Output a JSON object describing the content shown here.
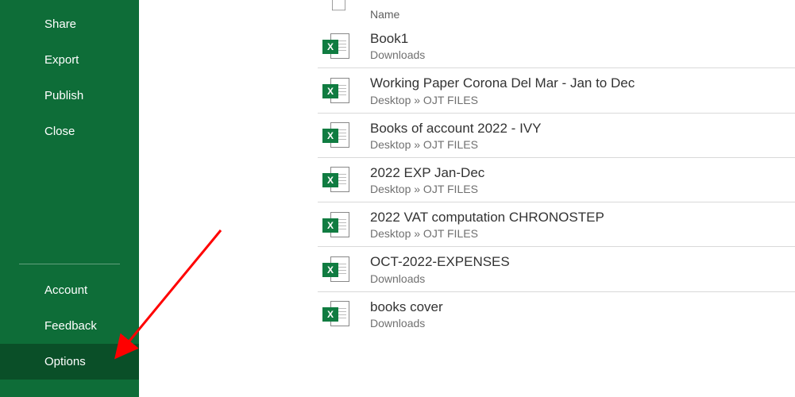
{
  "sidebar": {
    "top": [
      {
        "label": "Share"
      },
      {
        "label": "Export"
      },
      {
        "label": "Publish"
      },
      {
        "label": "Close"
      }
    ],
    "bottom": [
      {
        "label": "Account"
      },
      {
        "label": "Feedback"
      },
      {
        "label": "Options",
        "selected": true
      }
    ]
  },
  "list": {
    "header_partial": "Name",
    "files": [
      {
        "title": "Book1",
        "path": "Downloads"
      },
      {
        "title": "Working Paper Corona Del Mar - Jan to Dec",
        "path": "Desktop » OJT FILES"
      },
      {
        "title": "Books of account 2022 - IVY",
        "path": "Desktop » OJT FILES"
      },
      {
        "title": "2022 EXP Jan-Dec",
        "path": "Desktop » OJT FILES"
      },
      {
        "title": "2022 VAT computation CHRONOSTEP",
        "path": "Desktop » OJT FILES"
      },
      {
        "title": "OCT-2022-EXPENSES",
        "path": "Downloads"
      },
      {
        "title": "books cover",
        "path": "Downloads"
      }
    ]
  }
}
